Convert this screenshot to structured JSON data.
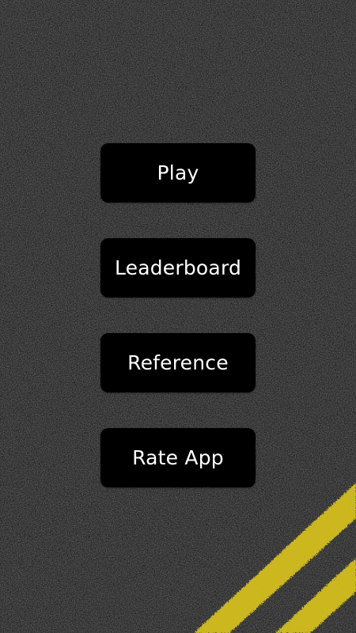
{
  "menu": {
    "play_label": "Play",
    "leaderboard_label": "Leaderboard",
    "reference_label": "Reference",
    "rate_app_label": "Rate App"
  },
  "colors": {
    "button_background": "#000000",
    "button_text": "#ffffff",
    "asphalt": "#2b2b2b",
    "stripe_yellow": "#d8c21e"
  }
}
